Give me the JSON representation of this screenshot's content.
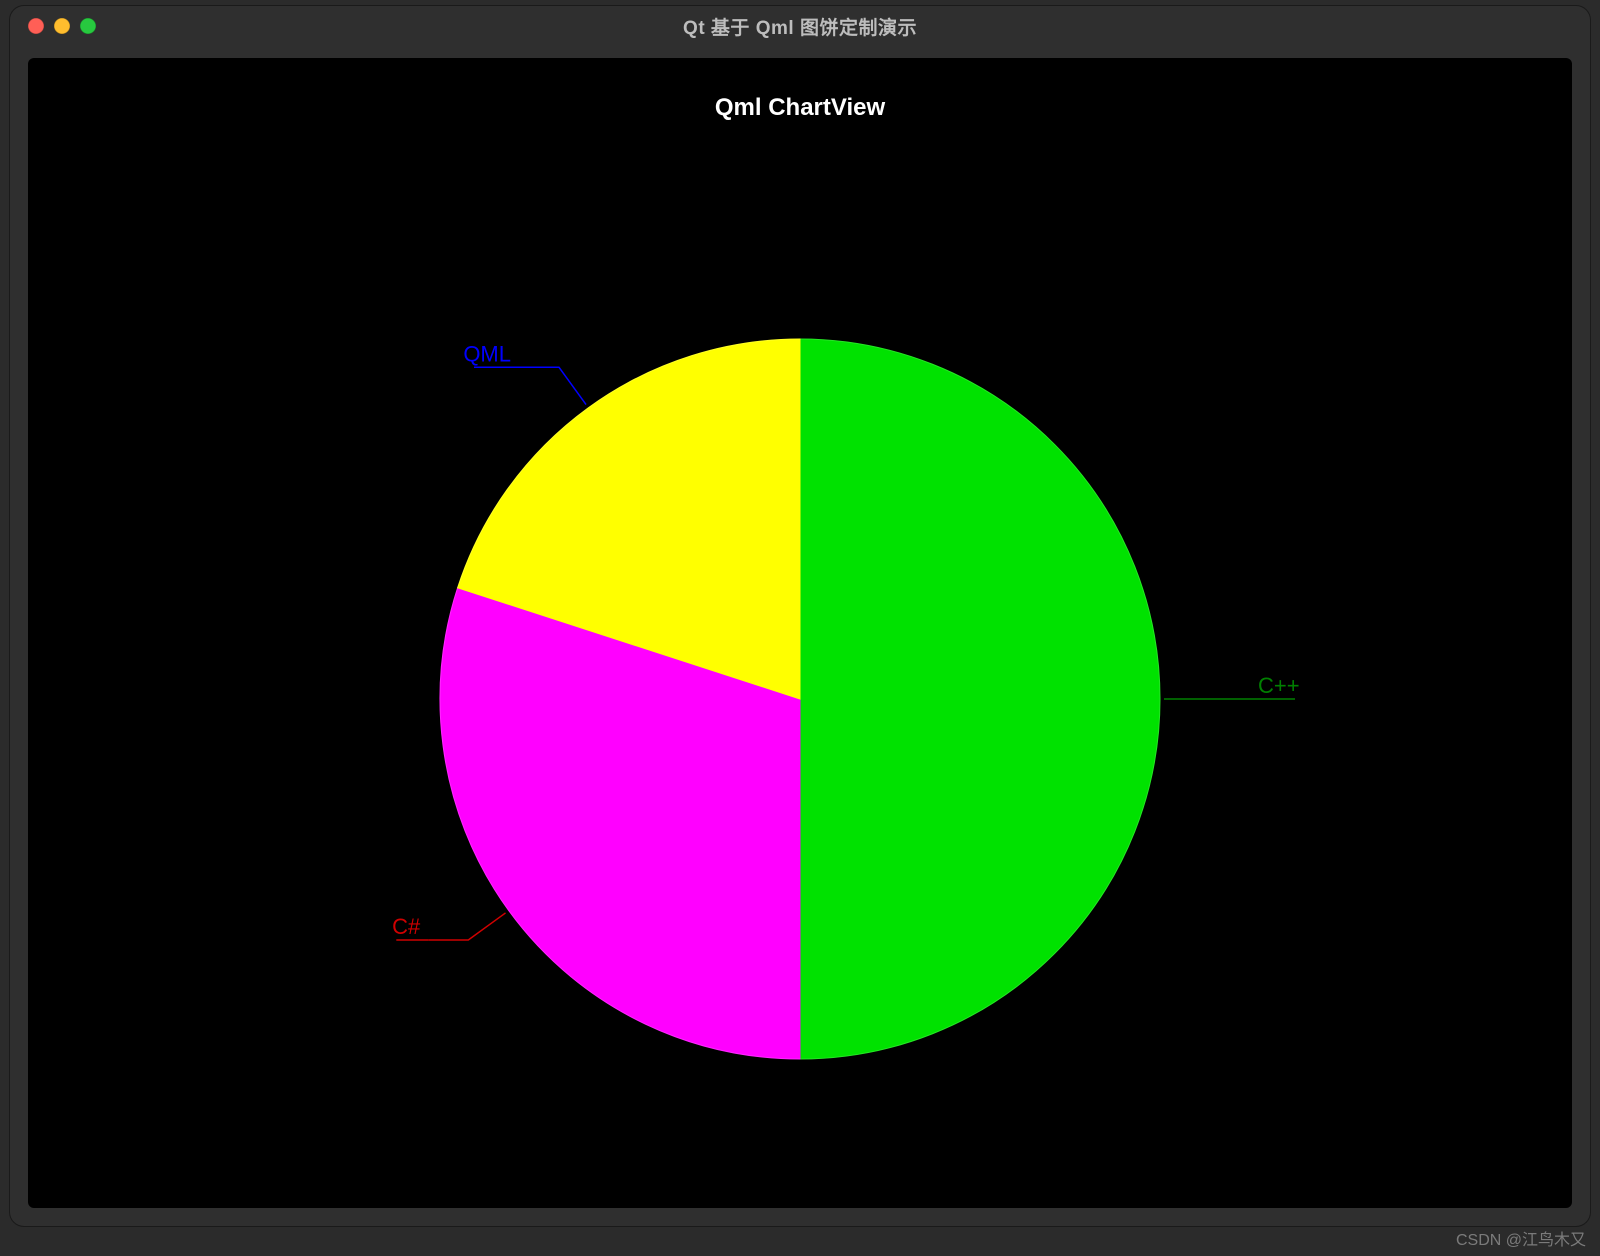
{
  "window": {
    "title": "Qt 基于 Qml 图饼定制演示"
  },
  "chart_data": {
    "type": "pie",
    "title": "Qml ChartView",
    "series": [
      {
        "name": "C++",
        "value": 50,
        "color": "#00E200",
        "label_color": "#008000"
      },
      {
        "name": "C#",
        "value": 30,
        "color": "#FF00FF",
        "label_color": "#D00000"
      },
      {
        "name": "QML",
        "value": 20,
        "color": "#FFFF00",
        "label_color": "#0000FF"
      }
    ],
    "start_angle_deg": 0,
    "legend": "outside-with-leader"
  },
  "watermark": "CSDN @江鸟木又"
}
